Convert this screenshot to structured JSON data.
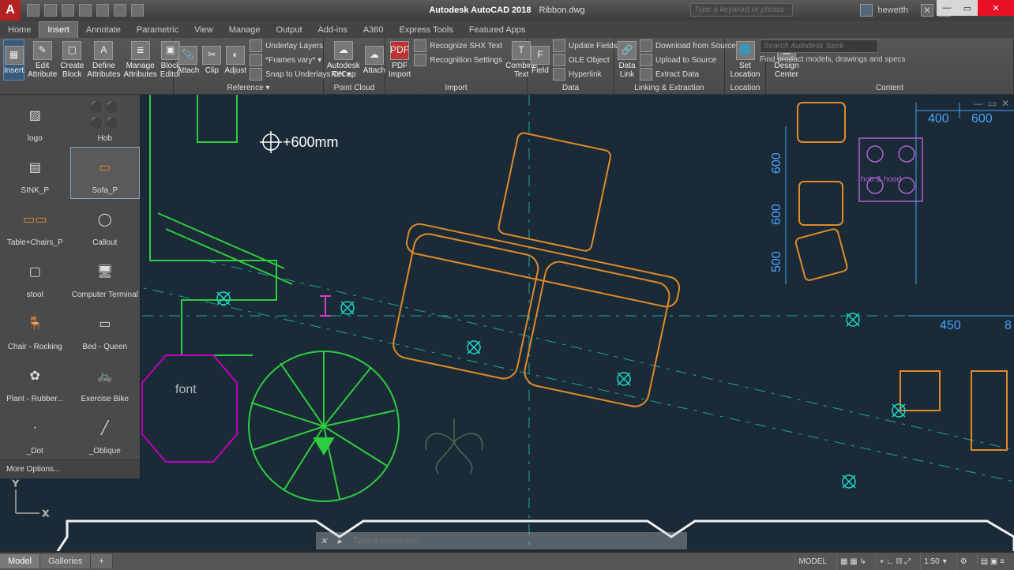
{
  "title": {
    "app": "Autodesk AutoCAD 2018",
    "file": "Ribbon.dwg"
  },
  "search_placeholder": "Type a keyword or phrase",
  "user": "hewetth",
  "menu_tabs": [
    "Home",
    "Insert",
    "Annotate",
    "Parametric",
    "View",
    "Manage",
    "Output",
    "Add-ins",
    "A360",
    "Express Tools",
    "Featured Apps"
  ],
  "active_menu_tab": "Insert",
  "ribbon": {
    "block": {
      "insert": "Insert",
      "edit_attr": "Edit\nAttribute",
      "create": "Create\nBlock",
      "define": "Define\nAttributes",
      "manage": "Manage\nAttributes",
      "editor": "Block\nEditor"
    },
    "reference": {
      "attach": "Attach",
      "clip": "Clip",
      "adjust": "Adjust",
      "underlay": "Underlay Layers",
      "frames": "*Frames vary* ▾",
      "snap": "Snap to Underlays ON ▾",
      "title": "Reference ▾"
    },
    "pointcloud": {
      "recap": "Autodesk\nReCap",
      "attach": "Attach",
      "title": "Point Cloud"
    },
    "import": {
      "pdf": "PDF\nImport",
      "shx": "Recognize SHX Text",
      "recset": "Recognition Settings",
      "combine": "Combine\nText",
      "title": "Import"
    },
    "data": {
      "field": "Field",
      "update": "Update Fields",
      "ole": "OLE Object",
      "hyper": "Hyperlink",
      "link": "Data\nLink",
      "dl": "Download from Source",
      "ul": "Upload to Source",
      "ex": "Extract Data",
      "title": "Data",
      "title2": "Linking & Extraction"
    },
    "location": {
      "set": "Set\nLocation",
      "title": "Location"
    },
    "content": {
      "dc": "Design\nCenter",
      "seek_ph": "Search Autodesk Seek",
      "seek_hint": "Find product models, drawings and specs",
      "title": "Content"
    }
  },
  "palette": {
    "items": [
      {
        "label": "logo"
      },
      {
        "label": "Hob"
      },
      {
        "label": "SINK_P"
      },
      {
        "label": "Sofa_P"
      },
      {
        "label": "Table+Chairs_P"
      },
      {
        "label": "Callout"
      },
      {
        "label": "stool"
      },
      {
        "label": "Computer Terminal"
      },
      {
        "label": "Chair - Rocking"
      },
      {
        "label": "Bed - Queen"
      },
      {
        "label": "Plant - Rubber..."
      },
      {
        "label": "Exercise Bike"
      },
      {
        "label": "_Dot"
      },
      {
        "label": "_Oblique"
      }
    ],
    "selected": 3,
    "footer": "More Options..."
  },
  "canvas": {
    "elevation": "+600mm",
    "font_label": "font",
    "dims": {
      "d400": "400",
      "d600": "600",
      "d600b": "600",
      "d600c": "600",
      "d500": "500",
      "d450": "450",
      "d8": "8"
    },
    "hob_label": "hob &\nhood"
  },
  "bottom_tabs": [
    "Model",
    "Galleries"
  ],
  "active_bottom_tab": "Model",
  "cmd_placeholder": "Type a command",
  "status": {
    "model": "MODEL",
    "scale": "1:50"
  }
}
